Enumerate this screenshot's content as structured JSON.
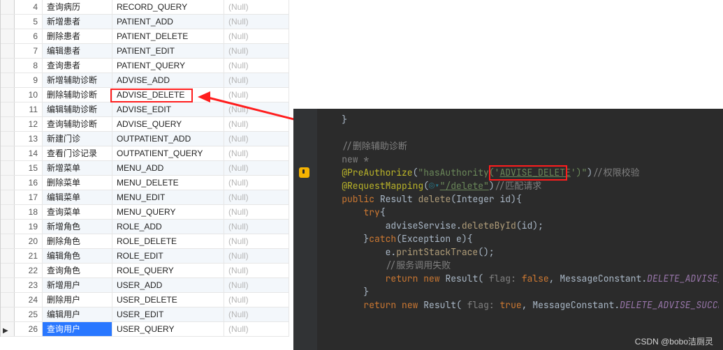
{
  "table": {
    "null_text": "(Null)",
    "rows": [
      {
        "n": 4,
        "name": "查询病历",
        "perm": "RECORD_QUERY"
      },
      {
        "n": 5,
        "name": "新增患者",
        "perm": "PATIENT_ADD"
      },
      {
        "n": 6,
        "name": "删除患者",
        "perm": "PATIENT_DELETE"
      },
      {
        "n": 7,
        "name": "编辑患者",
        "perm": "PATIENT_EDIT"
      },
      {
        "n": 8,
        "name": "查询患者",
        "perm": "PATIENT_QUERY"
      },
      {
        "n": 9,
        "name": "新增辅助诊断",
        "perm": "ADVISE_ADD"
      },
      {
        "n": 10,
        "name": "删除辅助诊断",
        "perm": "ADVISE_DELETE"
      },
      {
        "n": 11,
        "name": "编辑辅助诊断",
        "perm": "ADVISE_EDIT"
      },
      {
        "n": 12,
        "name": "查询辅助诊断",
        "perm": "ADVISE_QUERY"
      },
      {
        "n": 13,
        "name": "新建门诊",
        "perm": "OUTPATIENT_ADD"
      },
      {
        "n": 14,
        "name": "查看门诊记录",
        "perm": "OUTPATIENT_QUERY"
      },
      {
        "n": 15,
        "name": "新增菜单",
        "perm": "MENU_ADD"
      },
      {
        "n": 16,
        "name": "删除菜单",
        "perm": "MENU_DELETE"
      },
      {
        "n": 17,
        "name": "编辑菜单",
        "perm": "MENU_EDIT"
      },
      {
        "n": 18,
        "name": "查询菜单",
        "perm": "MENU_QUERY"
      },
      {
        "n": 19,
        "name": "新增角色",
        "perm": "ROLE_ADD"
      },
      {
        "n": 20,
        "name": "删除角色",
        "perm": "ROLE_DELETE"
      },
      {
        "n": 21,
        "name": "编辑角色",
        "perm": "ROLE_EDIT"
      },
      {
        "n": 22,
        "name": "查询角色",
        "perm": "ROLE_QUERY"
      },
      {
        "n": 23,
        "name": "新增用户",
        "perm": "USER_ADD"
      },
      {
        "n": 24,
        "name": "删除用户",
        "perm": "USER_DELETE"
      },
      {
        "n": 25,
        "name": "编辑用户",
        "perm": "USER_EDIT"
      },
      {
        "n": 26,
        "name": "查询用户",
        "perm": "USER_QUERY"
      }
    ],
    "highlighted_row": 10,
    "selected_row": 26
  },
  "code": {
    "comment_delete": "删除辅助诊断",
    "comment_auth": "权限校验",
    "comment_match": "匹配请求",
    "comment_fail": "服务调用失败",
    "annotation1": "@PreAuthorize",
    "auth_arg": "\"hasAuthority('",
    "auth_perm": "ADVISE_DELETE",
    "auth_arg2": "')\"",
    "annotation2": "@RequestMapping",
    "mapping_path": "\"/delete\"",
    "kw_public": "public",
    "kw_try": "try",
    "kw_catch": "catch",
    "kw_return": "return",
    "kw_new": "new",
    "type_result": "Result",
    "type_integer": "Integer",
    "type_exception": "Exception",
    "method": "delete",
    "param": "id",
    "svc_var": "adviseServise",
    "svc_call": "deleteById",
    "exc_var": "e",
    "exc_call": "printStackTrace",
    "hint_flag": "flag:",
    "val_false": "false",
    "val_true": "true",
    "const_class": "MessageConstant",
    "const_fail": "DELETE_ADVISE_FAIL",
    "const_ok": "DELETE_ADVISE_SUCCESS",
    "kw_newstar": "new *"
  },
  "watermark": "CSDN @bobo洁厕灵"
}
